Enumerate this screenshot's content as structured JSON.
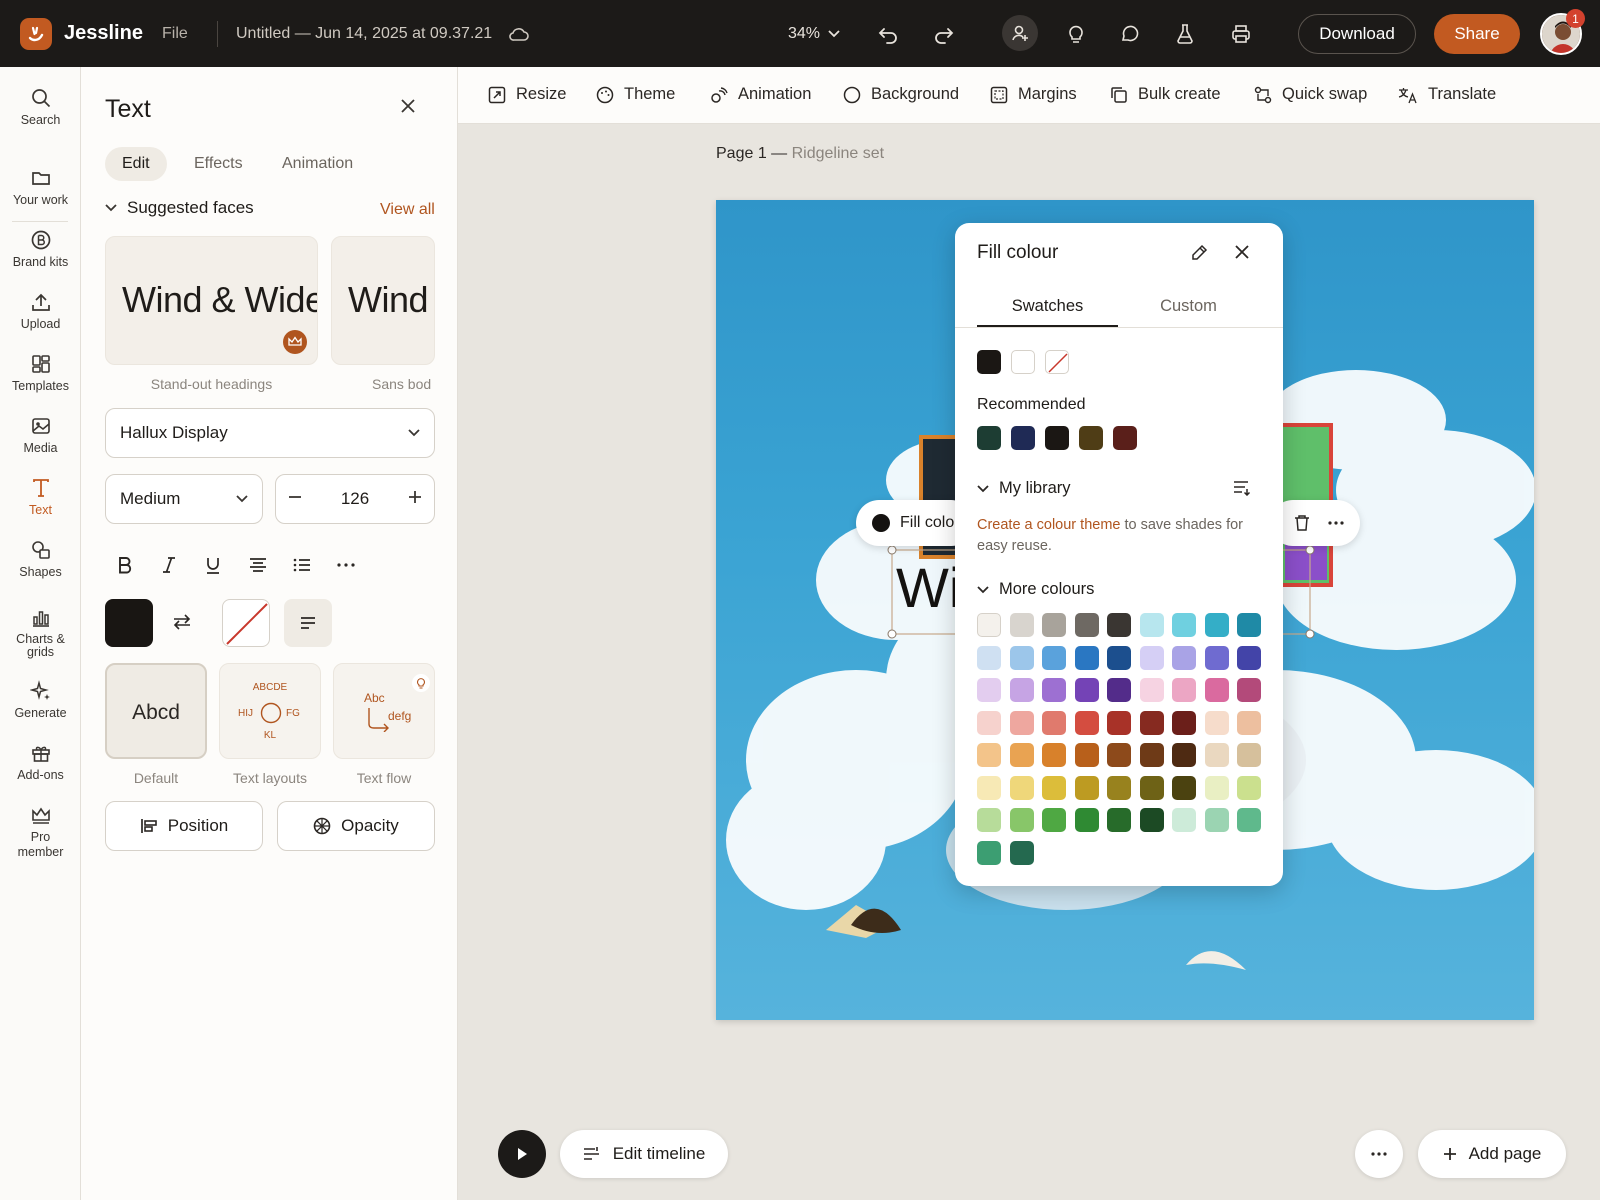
{
  "app": {
    "name": "Jessline",
    "file_menu": "File",
    "doc_title": "Untitled — Jun 14, 2025 at 09.37.21",
    "zoom": "34%",
    "download": "Download",
    "share": "Share",
    "notif_count": "1",
    "accent": "#c25a21"
  },
  "rail": [
    {
      "label": "Search",
      "icon": "search-icon"
    },
    {
      "label": "Your work",
      "icon": "folder-icon"
    },
    {
      "label": "Brand kits",
      "icon": "brand-icon"
    },
    {
      "label": "Upload",
      "icon": "upload-icon"
    },
    {
      "label": "Templates",
      "icon": "templates-icon"
    },
    {
      "label": "Media",
      "icon": "image-icon"
    },
    {
      "label": "Text",
      "icon": "text-icon"
    },
    {
      "label": "Shapes",
      "icon": "shapes-icon"
    },
    {
      "label": "Charts &\ngrids",
      "icon": "chart-icon"
    },
    {
      "label": "Generate",
      "icon": "sparkle-icon"
    },
    {
      "label": "Add-ons",
      "icon": "gift-icon"
    },
    {
      "label": "Pro\nmember",
      "icon": "crown-icon"
    }
  ],
  "panel": {
    "title": "Text",
    "tabs": [
      "Edit",
      "Effects",
      "Animation"
    ],
    "suggested_title": "Suggested faces",
    "view_all": "View all",
    "faces": [
      {
        "sample": "Wind & Wide",
        "caption": "Stand-out headings"
      },
      {
        "sample": "Wind &",
        "caption": "Sans bod"
      }
    ],
    "font": "Hallux Display",
    "weight": "Medium",
    "size": "126",
    "styles": [
      {
        "caption": "Default",
        "sample": "Abcd"
      },
      {
        "caption": "Text layouts",
        "sample_top": "ABCDE",
        "sample_l": "HIJ",
        "sample_r": "FG",
        "sample_b": "KL"
      },
      {
        "caption": "Text flow",
        "sample_a": "Abc",
        "sample_b": "defg"
      }
    ],
    "position": "Position",
    "opacity": "Opacity"
  },
  "ctxbar": [
    "Resize",
    "Theme",
    "Animation",
    "Background",
    "Margins",
    "Bulk create",
    "Quick swap",
    "Translate"
  ],
  "canvas": {
    "page_label": "Page 1 —",
    "page_sub": "Ridgeline set",
    "float_label": "Fill colo",
    "text_fragment": "Wi"
  },
  "fill": {
    "title": "Fill colour",
    "tabs": [
      "Swatches",
      "Custom"
    ],
    "basic": [
      "#1b1714",
      "#ffffff",
      "none"
    ],
    "recommended_title": "Recommended",
    "recommended": [
      "#1d3d33",
      "#1f2a55",
      "#1b1714",
      "#4f3d16",
      "#5a1f1a"
    ],
    "library_title": "My library",
    "library_link": "Create a colour theme",
    "library_note": "to save shades for easy reuse.",
    "more_title": "More colours",
    "more": [
      "#f4f1ec",
      "#d8d4ce",
      "#a8a39b",
      "#6e6963",
      "#3a3632",
      "#b7e6ee",
      "#6fd0e0",
      "#34aec7",
      "#1f8aa6",
      "#cfe0f2",
      "#9cc6ea",
      "#5aa2dc",
      "#2a77c2",
      "#1c4f8e",
      "#d5cff5",
      "#a9a3e6",
      "#6f6bd0",
      "#4344a8",
      "#e3cdef",
      "#c6a4e4",
      "#9d70d2",
      "#7443b6",
      "#532c8a",
      "#f6d3e2",
      "#eca6c4",
      "#da6a9f",
      "#b34a7a",
      "#f6d2cd",
      "#eea79f",
      "#e07a6d",
      "#d44d40",
      "#a83228",
      "#862a20",
      "#6b1f1a",
      "#f6dccb",
      "#edbf9f",
      "#f3c48a",
      "#e9a352",
      "#d8812b",
      "#b8601b",
      "#8d4a1b",
      "#6e3a17",
      "#4e2a12",
      "#ead8c0",
      "#d6c09c",
      "#f7e9b5",
      "#efd77a",
      "#dcbd3a",
      "#bd9b22",
      "#98821e",
      "#6e6216",
      "#4b4210",
      "#e9efc3",
      "#cbe08e",
      "#b7dc9a",
      "#88c669",
      "#4fa843",
      "#2f8a33",
      "#276b2a",
      "#1c4a24",
      "#cdebd9",
      "#9bd4b2",
      "#5fb98c",
      "#3c9e72",
      "#24694f"
    ]
  },
  "bottom": {
    "edit_timeline": "Edit timeline",
    "add_page": "Add page"
  }
}
